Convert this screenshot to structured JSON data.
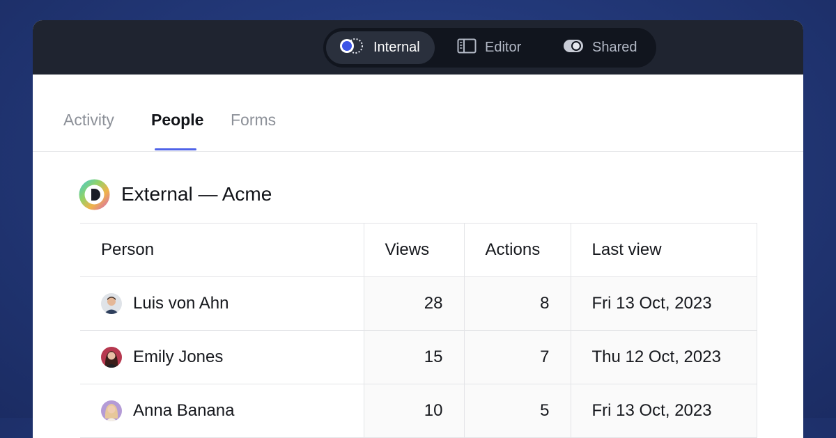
{
  "mode_switch": {
    "items": [
      {
        "label": "Internal",
        "icon": "internal-ring-icon",
        "active": true
      },
      {
        "label": "Editor",
        "icon": "editor-panel-icon",
        "active": false
      },
      {
        "label": "Shared",
        "icon": "shared-toggle-icon",
        "active": false
      }
    ]
  },
  "tabs": [
    {
      "label": "Activity",
      "active": false
    },
    {
      "label": "People",
      "active": true
    },
    {
      "label": "Forms",
      "active": false
    }
  ],
  "group": {
    "title": "External — Acme",
    "logo_icon": "gradient-d-logo"
  },
  "table": {
    "headers": [
      "Person",
      "Views",
      "Actions",
      "Last view"
    ],
    "rows": [
      {
        "name": "Luis von Ahn",
        "views": "28",
        "actions": "8",
        "last_view": "Fri 13 Oct, 2023",
        "avatar_color": "#5b6470"
      },
      {
        "name": "Emily Jones",
        "views": "15",
        "actions": "7",
        "last_view": "Thu 12 Oct, 2023",
        "avatar_color": "#a3324b"
      },
      {
        "name": "Anna Banana",
        "views": "10",
        "actions": "5",
        "last_view": "Fri 13 Oct, 2023",
        "avatar_color": "#c9a27a"
      }
    ]
  },
  "colors": {
    "accent": "#4f63e8",
    "topbar": "#1f2430",
    "background": "#23397a"
  }
}
